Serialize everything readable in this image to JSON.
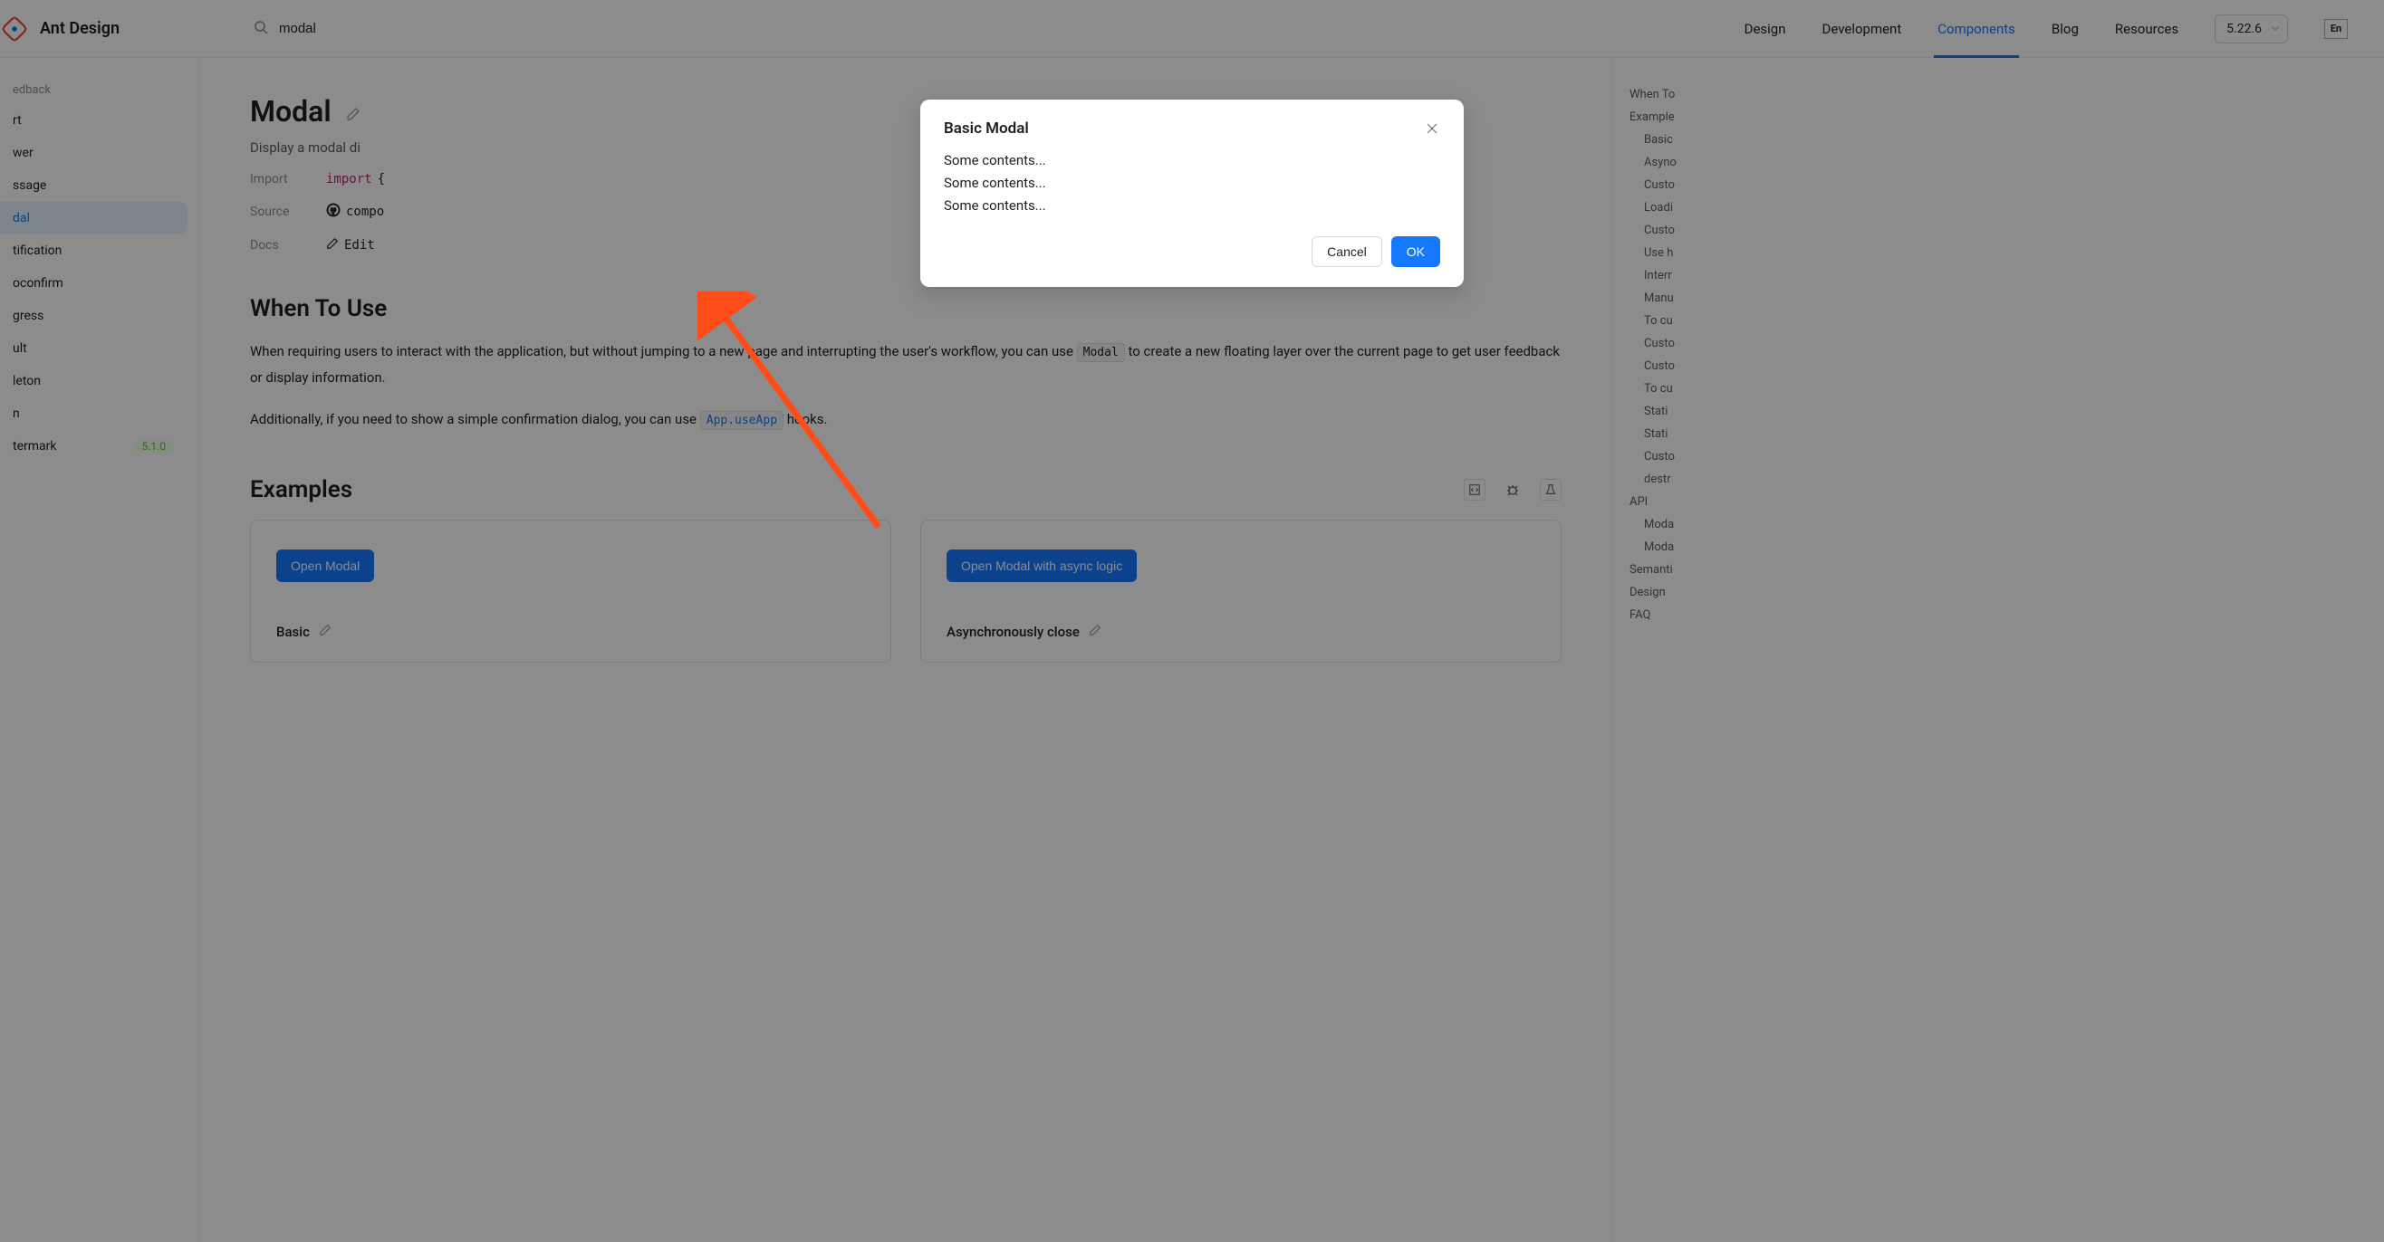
{
  "header": {
    "logo_text": "Ant Design",
    "search_value": "modal",
    "nav": [
      "Design",
      "Development",
      "Components",
      "Blog",
      "Resources"
    ],
    "nav_active_index": 2,
    "version": "5.22.6",
    "lang": "En"
  },
  "sidebar": {
    "group": "edback",
    "items": [
      {
        "label": "rt"
      },
      {
        "label": "wer"
      },
      {
        "label": "ssage"
      },
      {
        "label": "dal",
        "active": true
      },
      {
        "label": "tification"
      },
      {
        "label": "oconfirm"
      },
      {
        "label": "gress"
      },
      {
        "label": "ult"
      },
      {
        "label": "leton"
      },
      {
        "label": "n"
      },
      {
        "label": "termark",
        "badge": "5.1.0"
      }
    ]
  },
  "page": {
    "title": "Modal",
    "subtitle_prefix": "Display a modal di",
    "import_label": "Import",
    "import_keyword": "import",
    "import_rest": " {",
    "source_label": "Source",
    "source_value": "compo",
    "docs_label": "Docs",
    "docs_value": "Edit",
    "when_heading": "When To Use",
    "when_text_1a": "When requiring users to interact with the application, but without jumping to a new page and interrupting the user's workflow, you can use ",
    "when_code_1": "Modal",
    "when_text_1b": " to create a new floating layer over the current page to get user feedback or display information.",
    "when_text_2a": "Additionally, if you need to show a simple confirmation dialog, you can use ",
    "when_code_2": "App.useApp",
    "when_text_2b": " hooks.",
    "examples_heading": "Examples",
    "examples": [
      {
        "button": "Open Modal",
        "title": "Basic"
      },
      {
        "button": "Open Modal with async logic",
        "title": "Asynchronously close"
      }
    ]
  },
  "toc": {
    "top": [
      "When To",
      "Example"
    ],
    "examples": [
      "Basic",
      "Asyno",
      "Custo",
      "Loadi",
      "Custo",
      "Use h",
      "Interr",
      "Manu",
      "To cu",
      "Custo",
      "Custo",
      "To cu",
      "Stati",
      "Stati",
      "Custo",
      "destr"
    ],
    "sections": [
      "API",
      "Semanti",
      "Design",
      "FAQ"
    ],
    "api_sub": [
      "Moda",
      "Moda"
    ]
  },
  "modal": {
    "title": "Basic Modal",
    "content": [
      "Some contents...",
      "Some contents...",
      "Some contents..."
    ],
    "cancel": "Cancel",
    "ok": "OK"
  }
}
